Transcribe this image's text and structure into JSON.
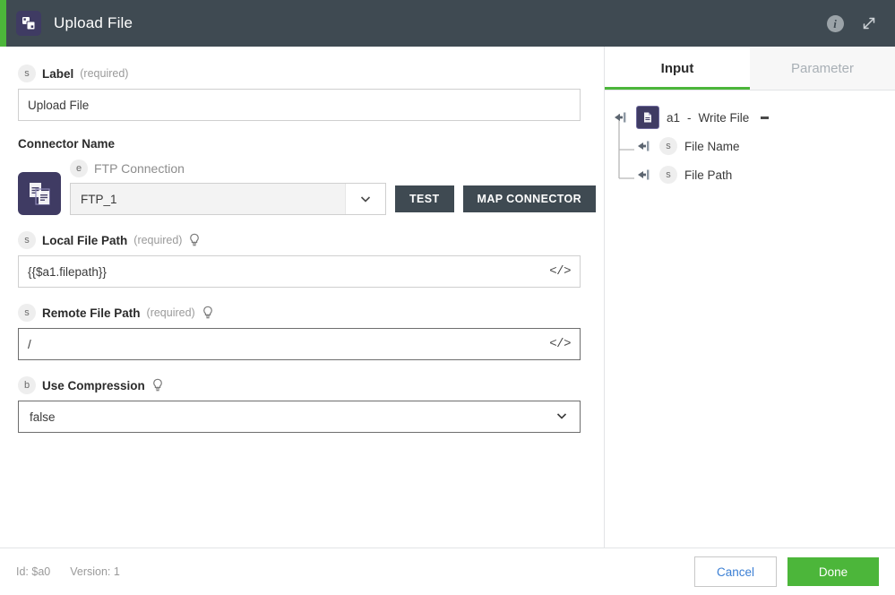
{
  "window": {
    "title": "Upload File",
    "icon": "overlapping-squares-icon",
    "accent_color": "#4cb63a",
    "header_bg": "#3f4a52",
    "info_icon": "info-icon",
    "expand_icon": "expand-diagonal-icon"
  },
  "form": {
    "label_field": {
      "badge": "s",
      "name": "Label",
      "required": "(required)",
      "value": "Upload File"
    },
    "connector": {
      "section_title": "Connector Name",
      "tile_icon": "ftp-documents-icon",
      "sub_badge": "e",
      "sub_name": "FTP Connection",
      "selected": "FTP_1",
      "caret": "chevron-down-icon",
      "test_label": "TEST",
      "map_label": "MAP CONNECTOR"
    },
    "local_file_path": {
      "badge": "s",
      "name": "Local File Path",
      "required": "(required)",
      "hint_icon": "lightbulb-icon",
      "value": "{{$a1.filepath}}",
      "code_toggle": "</>"
    },
    "remote_file_path": {
      "badge": "s",
      "name": "Remote File Path",
      "required": "(required)",
      "hint_icon": "lightbulb-icon",
      "value": "/",
      "code_toggle": "</>"
    },
    "use_compression": {
      "badge": "b",
      "name": "Use Compression",
      "hint_icon": "lightbulb-icon",
      "value": "false",
      "options": [
        "false",
        "true"
      ],
      "caret": "chevron-down-icon"
    }
  },
  "side_panel": {
    "tabs": [
      {
        "label": "Input",
        "active": true
      },
      {
        "label": "Parameter",
        "active": false
      }
    ],
    "tree": {
      "root": {
        "id": "a1",
        "separator": "-",
        "name": "Write File",
        "icon": "file-node-icon",
        "arrow_icon": "input-arrow-icon",
        "marker": "collapse-dash-icon"
      },
      "children": [
        {
          "badge": "s",
          "label": "File Name",
          "arrow_icon": "input-arrow-icon"
        },
        {
          "badge": "s",
          "label": "File Path",
          "arrow_icon": "input-arrow-icon"
        }
      ]
    }
  },
  "footer": {
    "id_text": "Id: $a0",
    "version_text": "Version: 1",
    "cancel_label": "Cancel",
    "done_label": "Done"
  }
}
